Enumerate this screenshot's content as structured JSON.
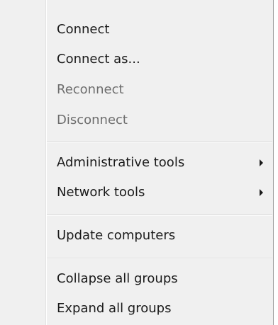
{
  "menu": {
    "items": [
      {
        "label": "Connect",
        "enabled": true,
        "submenu": false
      },
      {
        "label": "Connect as...",
        "enabled": true,
        "submenu": false
      },
      {
        "label": "Reconnect",
        "enabled": false,
        "submenu": false
      },
      {
        "label": "Disconnect",
        "enabled": false,
        "submenu": false
      },
      {
        "label": "Administrative tools",
        "enabled": true,
        "submenu": true,
        "arrow_icon": "chevron-right-icon"
      },
      {
        "label": "Network tools",
        "enabled": true,
        "submenu": true,
        "arrow_icon": "chevron-right-icon"
      },
      {
        "label": "Update computers",
        "enabled": true,
        "submenu": false
      },
      {
        "label": "Collapse all groups",
        "enabled": true,
        "submenu": false
      },
      {
        "label": "Expand all groups",
        "enabled": true,
        "submenu": false
      }
    ],
    "colors": {
      "background": "#f0f0f0",
      "text": "#1a1a1a",
      "disabled_text": "#6d6d6d",
      "separator": "#d7d7d7"
    }
  }
}
